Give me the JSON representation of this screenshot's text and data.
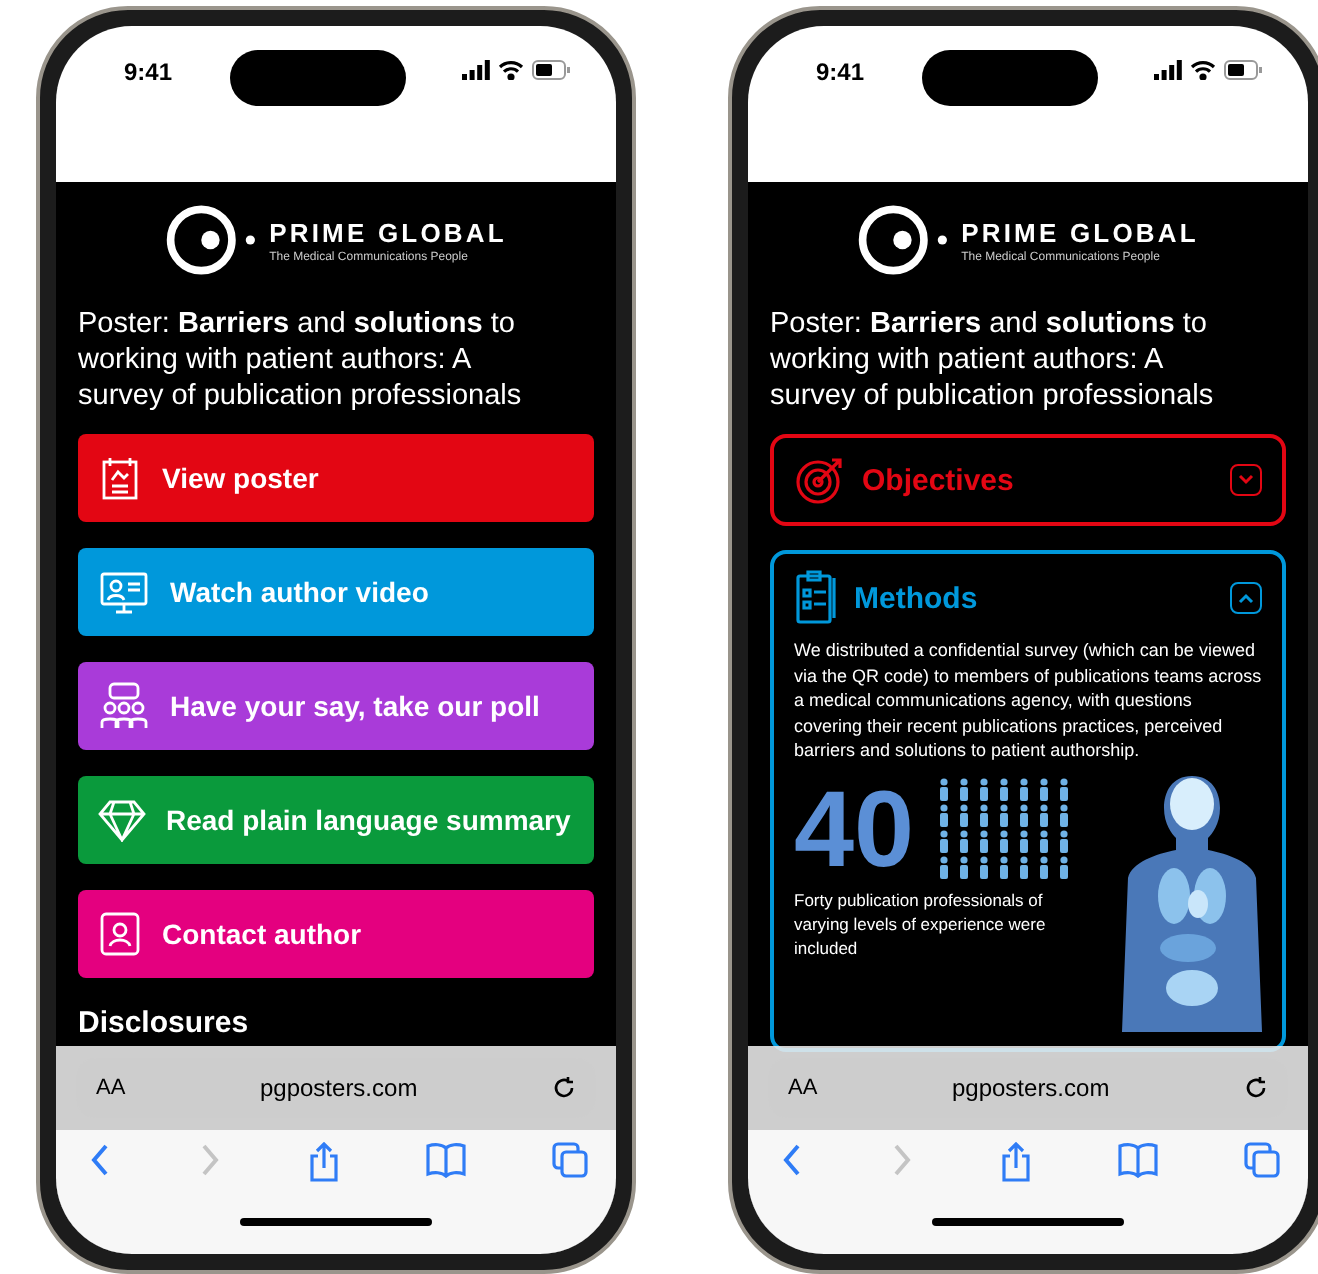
{
  "phones": [
    {
      "status_bar": {
        "time": "9:41"
      },
      "page": {
        "kind": "links",
        "logo": {
          "name": "PRIME GLOBAL",
          "tagline": "The Medical Communications People"
        },
        "title": "Poster: **Barriers** and **solutions** to working with patient authors: A survey of publication professionals",
        "links": [
          {
            "label": "View poster",
            "kind": "poster",
            "color": "#e30613"
          },
          {
            "label": "Watch author video",
            "kind": "video",
            "color": "#0098db"
          },
          {
            "label": "Have your say, take our poll",
            "kind": "poll",
            "color": "#a93bd9"
          },
          {
            "label": "Read plain language summary",
            "kind": "summary",
            "color": "#0a9a3c"
          },
          {
            "label": "Contact author",
            "kind": "contact",
            "color": "#e4007f"
          }
        ],
        "section_heading": "Disclosures"
      },
      "browser": {
        "text_size": "AA",
        "url": "pgposters.com",
        "back_enabled": true,
        "forward_enabled": false
      }
    },
    {
      "status_bar": {
        "time": "9:41"
      },
      "page": {
        "kind": "sections",
        "logo": {
          "name": "PRIME GLOBAL",
          "tagline": "The Medical Communications People"
        },
        "title": "Poster: **Barriers** and **solutions** to working with patient authors: A survey of publication professionals",
        "sections": [
          {
            "title": "Objectives",
            "kind": "objectives",
            "color": "#e30613",
            "expanded": false
          },
          {
            "title": "Methods",
            "kind": "methods",
            "color": "#0098db",
            "expanded": true,
            "body": "We distributed a confidential survey (which can be viewed via the QR code) to members of publications teams across a medical communications agency, with questions covering their recent publications practices, perceived barriers and solutions to patient authorship.",
            "stat": {
              "number": "40",
              "caption": "Forty publication professionals of varying levels of experience were included"
            }
          }
        ]
      },
      "browser": {
        "text_size": "AA",
        "url": "pgposters.com",
        "back_enabled": true,
        "forward_enabled": false
      }
    }
  ]
}
